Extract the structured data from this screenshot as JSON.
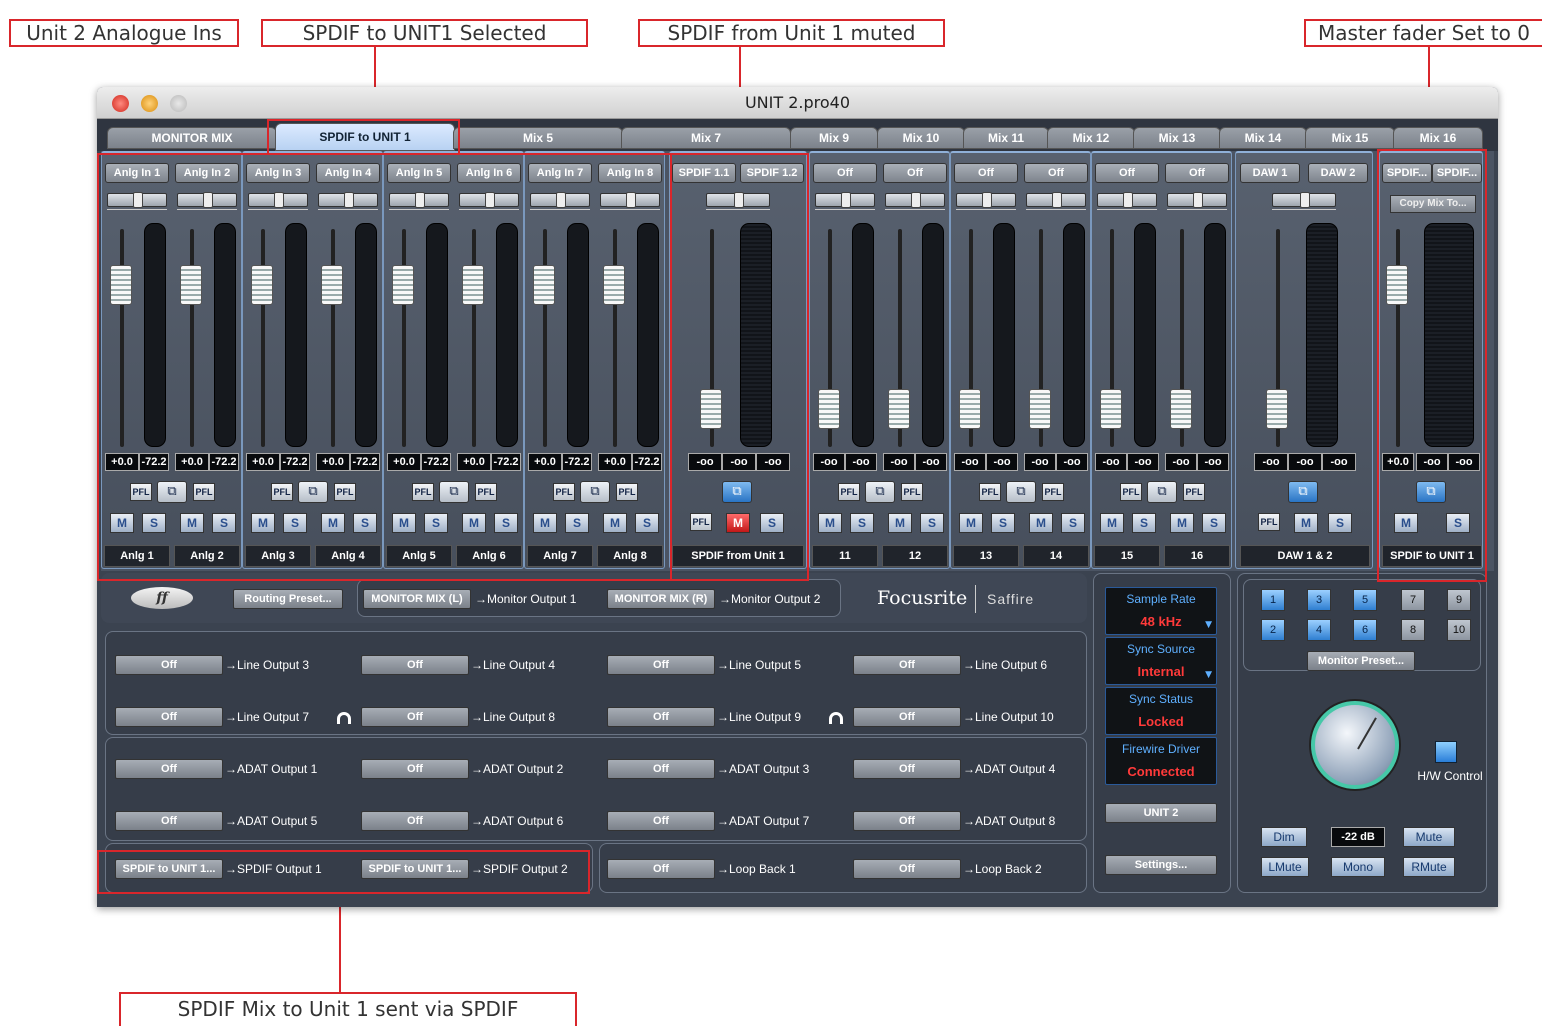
{
  "callouts": {
    "analogue": "Unit 2 Analogue Ins",
    "spdif_sel": "SPDIF to UNIT1 Selected",
    "spdif_muted": "SPDIF from Unit 1 muted",
    "master": "Master fader Set to 0",
    "spdif_sent": "SPDIF Mix to Unit 1 sent via SPDIF"
  },
  "window": {
    "title": "UNIT 2.pro40"
  },
  "tabs": [
    {
      "label": "MONITOR MIX"
    },
    {
      "label": "SPDIF to UNIT 1"
    },
    {
      "label": "Mix 5"
    },
    {
      "label": "Mix 7"
    },
    {
      "label": "Mix 9"
    },
    {
      "label": "Mix 10"
    },
    {
      "label": "Mix 11"
    },
    {
      "label": "Mix 12"
    },
    {
      "label": "Mix 13"
    },
    {
      "label": "Mix 14"
    },
    {
      "label": "Mix 15"
    },
    {
      "label": "Mix 16"
    }
  ],
  "channels": {
    "inputs": [
      "Anlg In 1",
      "Anlg In 2",
      "Anlg In 3",
      "Anlg In 4",
      "Anlg In 5",
      "Anlg In 6",
      "Anlg In 7",
      "Anlg In 8"
    ],
    "names": [
      "Anlg 1",
      "Anlg 2",
      "Anlg 3",
      "Anlg 4",
      "Anlg 5",
      "Anlg 6",
      "Anlg 7",
      "Anlg 8"
    ],
    "gain": "+0.0",
    "peak": "-72.2",
    "spdif_in": [
      "SPDIF 1.1",
      "SPDIF 1.2"
    ],
    "spdif_name": "SPDIF from Unit 1",
    "off": "Off",
    "inf": "-oo",
    "off_names": [
      "11",
      "12",
      "13",
      "14",
      "15",
      "16"
    ],
    "daw": [
      "DAW 1",
      "DAW 2"
    ],
    "daw_name": "DAW 1 & 2",
    "master_in": [
      "SPDIF...",
      "SPDIF..."
    ],
    "master_name": "SPDIF to UNIT 1",
    "copy_mix": "Copy Mix To...",
    "pfl": "PFL",
    "m": "M",
    "s": "S",
    "link": "⧉"
  },
  "routing": {
    "preset": "Routing Preset...",
    "mon_l": "MONITOR MIX (L)",
    "mon_l_out": "→Monitor Output 1",
    "mon_r": "MONITOR MIX (R)",
    "mon_r_out": "→Monitor Output 2",
    "brand": "Focusrite",
    "product": "Saffire",
    "off": "Off",
    "line": [
      "→Line Output 3",
      "→Line Output 4",
      "→Line Output 5",
      "→Line Output 6",
      "→Line Output 7",
      "→Line Output 8",
      "→Line Output 9",
      "→Line Output 10"
    ],
    "adat": [
      "→ADAT Output 1",
      "→ADAT Output 2",
      "→ADAT Output 3",
      "→ADAT Output 4",
      "→ADAT Output 5",
      "→ADAT Output 6",
      "→ADAT Output 7",
      "→ADAT Output 8"
    ],
    "spdif_src": "SPDIF to UNIT 1...",
    "spdif_out1": "→SPDIF Output 1",
    "spdif_out2": "→SPDIF Output 2",
    "loop1": "→Loop Back 1",
    "loop2": "→Loop Back 2"
  },
  "status": {
    "sample_rate_label": "Sample Rate",
    "sample_rate": "48 kHz",
    "sync_source_label": "Sync Source",
    "sync_source": "Internal",
    "sync_status_label": "Sync Status",
    "sync_status": "Locked",
    "firewire_label": "Firewire Driver",
    "firewire": "Connected",
    "unit": "UNIT 2",
    "settings": "Settings..."
  },
  "monitor": {
    "numbers": [
      "1",
      "3",
      "5",
      "7",
      "9",
      "2",
      "4",
      "6",
      "8",
      "10"
    ],
    "preset": "Monitor Preset...",
    "hw_control": "H/W Control",
    "dim": "Dim",
    "level": "-22 dB",
    "mute": "Mute",
    "lmute": "LMute",
    "mono": "Mono",
    "rmute": "RMute"
  }
}
